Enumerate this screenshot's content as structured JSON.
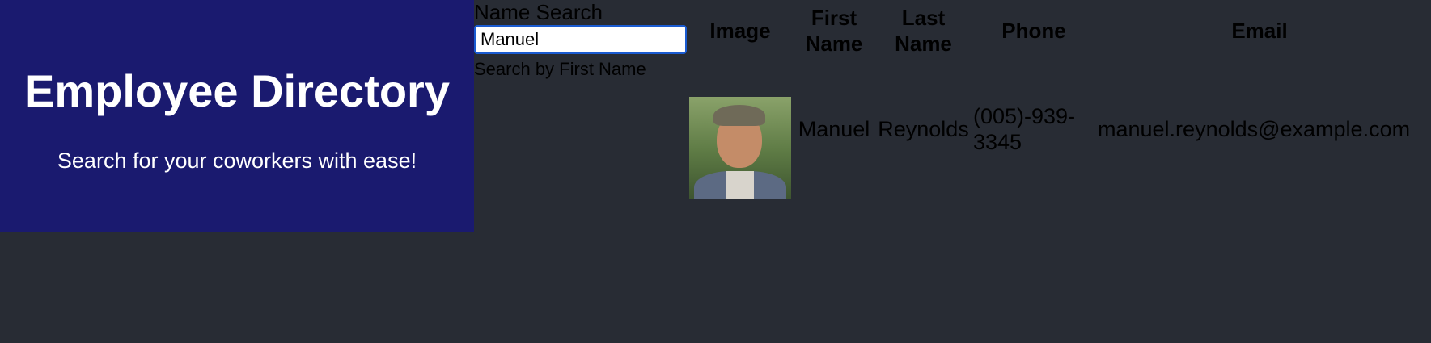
{
  "hero": {
    "title": "Employee Directory",
    "subtitle": "Search for your coworkers with ease!"
  },
  "search": {
    "label": "Name Search",
    "value": "Manuel",
    "hint": "Search by First Name"
  },
  "table": {
    "headers": {
      "image": "Image",
      "first_name": "First Name",
      "last_name": "Last Name",
      "phone": "Phone",
      "email": "Email"
    },
    "rows": [
      {
        "first_name": "Manuel",
        "last_name": "Reynolds",
        "phone": "(005)-939-3345",
        "email": "manuel.reynolds@example.com"
      }
    ]
  },
  "colors": {
    "background": "#282c34",
    "hero": "#1a1a6f",
    "input_border": "#1a5bd1"
  }
}
